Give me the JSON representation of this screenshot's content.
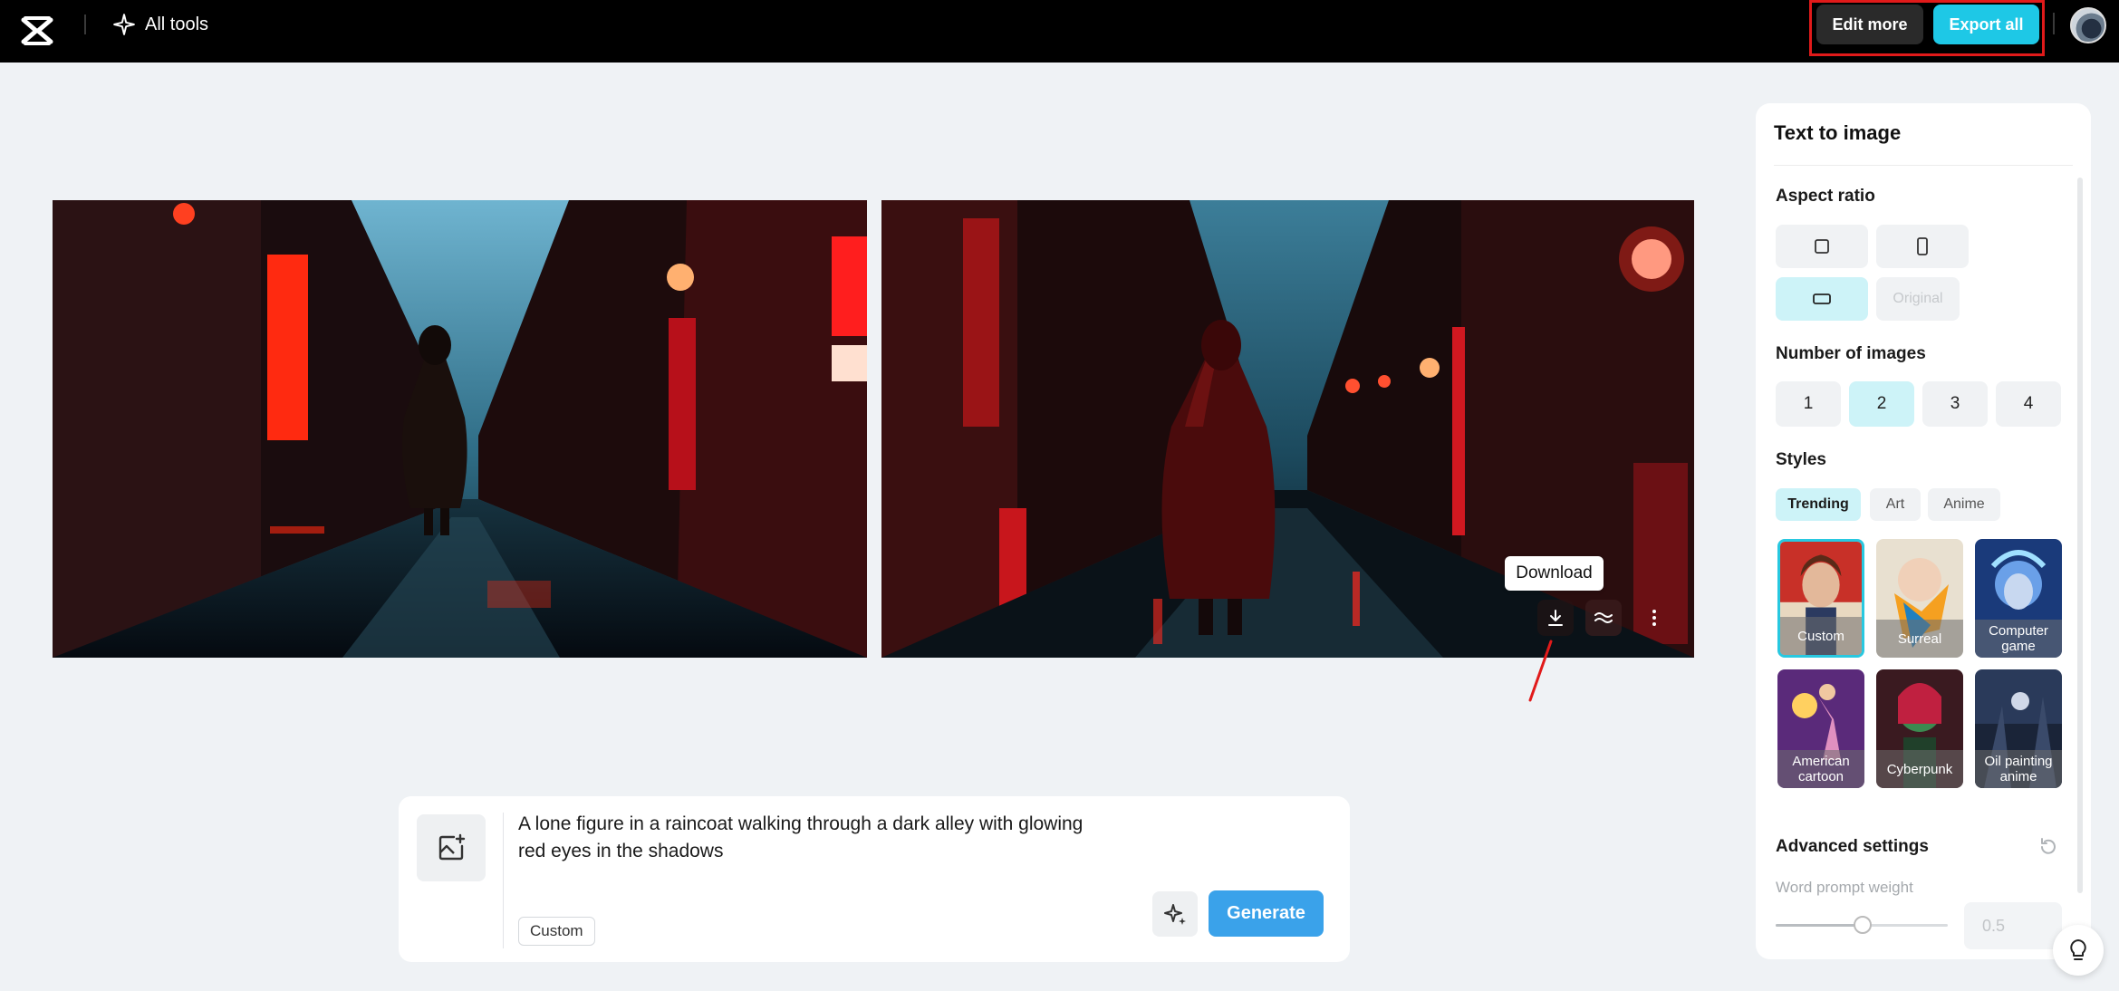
{
  "header": {
    "logo_icon": "capcut-logo-icon",
    "all_tools_label": "All tools",
    "edit_more_label": "Edit more",
    "export_all_label": "Export all"
  },
  "canvas": {
    "tooltip": "Download",
    "actions": [
      "download-icon",
      "upscale-icon",
      "more-icon"
    ]
  },
  "prompt": {
    "text": "A lone figure in a raincoat walking through a dark alley with glowing red eyes in the shadows",
    "style_chip": "Custom",
    "generate_label": "Generate"
  },
  "panel": {
    "title": "Text to image",
    "aspect_ratio_label": "Aspect ratio",
    "aspect_original_label": "Original",
    "number_label": "Number of images",
    "numbers": [
      "1",
      "2",
      "3",
      "4"
    ],
    "selected_number": "2",
    "styles_label": "Styles",
    "style_tabs": [
      "Trending",
      "Art",
      "Anime"
    ],
    "style_cards": [
      "Custom",
      "Surreal",
      "Computer game",
      "American cartoon",
      "Cyberpunk",
      "Oil painting anime"
    ],
    "advanced_label": "Advanced settings",
    "word_weight_label": "Word prompt weight",
    "word_weight_value": "0.5",
    "word_weight_fraction": 0.5
  },
  "colors": {
    "accent": "#1ec8e6",
    "generate": "#3aa2ea",
    "highlight": "#e11a1a"
  }
}
